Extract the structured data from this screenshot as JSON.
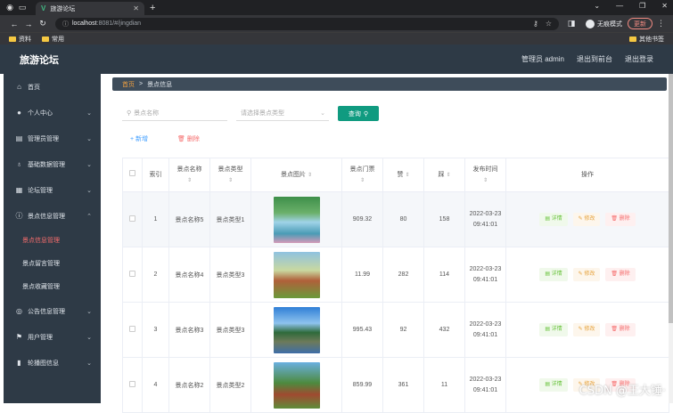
{
  "browser": {
    "tab_title": "旅游论坛",
    "url_host": "localhost",
    "url_path": ":8081/#/jingdian",
    "incognito_label": "无痕模式",
    "update_label": "更新",
    "bookmarks": [
      "资料",
      "常用"
    ],
    "other_bookmarks": "其他书签"
  },
  "app": {
    "title": "旅游论坛",
    "header_links": [
      "管理员 admin",
      "退出到前台",
      "退出登录"
    ]
  },
  "sidebar": {
    "items": [
      {
        "label": "首页",
        "icon": "home-icon",
        "chevron": false
      },
      {
        "label": "个人中心",
        "icon": "user-icon",
        "chevron": true
      },
      {
        "label": "管理员管理",
        "icon": "admin-icon",
        "chevron": true
      },
      {
        "label": "基础数据管理",
        "icon": "mic-icon",
        "chevron": true
      },
      {
        "label": "论坛管理",
        "icon": "forum-icon",
        "chevron": true
      },
      {
        "label": "景点信息管理",
        "icon": "info-icon",
        "chevron": "up"
      }
    ],
    "subitems": [
      "景点信息管理",
      "景点留言管理",
      "景点收藏管理"
    ],
    "items_after": [
      {
        "label": "公告信息管理",
        "icon": "notice-icon"
      },
      {
        "label": "用户管理",
        "icon": "flag-icon"
      },
      {
        "label": "轮播图信息",
        "icon": "chart-icon"
      }
    ]
  },
  "breadcrumb": {
    "home": "首页",
    "separator": ">",
    "current": "景点信息"
  },
  "search": {
    "name_placeholder": "景点名称",
    "type_placeholder": "请选择景点类型",
    "query_label": "查询"
  },
  "actions": {
    "add_label": "+ 新增",
    "delete_label": "删除"
  },
  "table": {
    "headers": [
      "索引",
      "景点名称",
      "景点类型",
      "景点图片",
      "景点门票",
      "赞",
      "踩",
      "发布时间",
      "操作"
    ],
    "rows": [
      {
        "index": "1",
        "name": "景点名称5",
        "type": "景点类型1",
        "price": "909.32",
        "like": "80",
        "dislike": "158",
        "time": "2022-03-23 09:41:01"
      },
      {
        "index": "2",
        "name": "景点名称4",
        "type": "景点类型3",
        "price": "11.99",
        "like": "282",
        "dislike": "114",
        "time": "2022-03-23 09:41:01"
      },
      {
        "index": "3",
        "name": "景点名称3",
        "type": "景点类型3",
        "price": "995.43",
        "like": "92",
        "dislike": "432",
        "time": "2022-03-23 09:41:01"
      },
      {
        "index": "4",
        "name": "景点名称2",
        "type": "景点类型2",
        "price": "859.99",
        "like": "361",
        "dislike": "11",
        "time": "2022-03-23 09:41:01"
      }
    ],
    "op_labels": {
      "detail": "详情",
      "edit": "修改",
      "delete": "删除"
    }
  },
  "watermark": "CSDN @王大锤·"
}
